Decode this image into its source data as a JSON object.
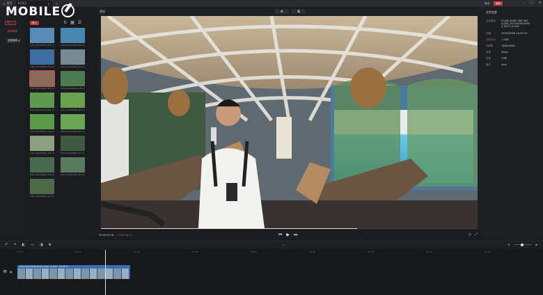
{
  "titlebar": {
    "home": "首页",
    "tab": "9月4日",
    "add": "+"
  },
  "logo": {
    "text": "MOBILE"
  },
  "left": {
    "import_label": "导入 ▾",
    "red_text": "所有媒体",
    "album_label": "全部媒体 ▴"
  },
  "media": {
    "import_label": "导入",
    "items": [
      {
        "cap": "CAM_20250906_001_D1994"
      },
      {
        "cap": "CAM_20250906_002_D1994"
      },
      {
        "cap": "CAM_20250906_003_D1994"
      },
      {
        "cap": "CAM_20250906_004_D1994"
      },
      {
        "cap": "CAM_20250906_005_D1994"
      },
      {
        "cap": "CAM_20250906_006_D1994"
      },
      {
        "cap": "CAM_20250906_007_D1994"
      },
      {
        "cap": "CAM_20250906_008_D1994"
      },
      {
        "cap": "CAM_20250906_009_D1994"
      },
      {
        "cap": "CAM_20250906_010_D1994"
      },
      {
        "cap": "CAM_20250906_011_D1994"
      },
      {
        "cap": "CAM_20250906_012_D1994"
      },
      {
        "cap": "CAM_20250906_013_D1994"
      },
      {
        "cap": "CAM_20250906_014_D1994"
      },
      {
        "cap": "CAM_20250906_015_D1994"
      }
    ]
  },
  "preview": {
    "label": "预览",
    "time_current": "00:00:30:18",
    "time_total": "00:00:48:03"
  },
  "topbar": {
    "export": "导出",
    "share": "保存"
  },
  "info": {
    "title": "文件信息",
    "rows": [
      {
        "k": "文件路径",
        "v": "E:\\\\DJI OSMO 360 360\\\\CAM_20250906140954_0007_D.OSV"
      },
      {
        "k": "日期",
        "v": "2025/09/06 14:09:54"
      },
      {
        "k": "文件大小",
        "v": "1.0GB"
      },
      {
        "k": "分辨率",
        "v": "7680x3840"
      },
      {
        "k": "帧率",
        "v": "50fps"
      },
      {
        "k": "码率",
        "v": "47秒"
      },
      {
        "k": "格式",
        "v": "hevc"
      }
    ]
  },
  "timeline": {
    "ticks": [
      "00:00",
      "00:10",
      "00:20",
      "00:30",
      "00:40",
      "00:50",
      "01:00",
      "01:10",
      "01:20",
      "01:30"
    ],
    "clip_label": "CAM_20250906140954_0007_D.OSV · 00:00:37"
  },
  "icons": [
    "home-icon",
    "settings-icon",
    "crop-icon",
    "undo-icon",
    "redo-icon",
    "play-icon",
    "prev-icon",
    "next-icon",
    "fullscreen-icon",
    "eye-icon",
    "lock-icon"
  ]
}
